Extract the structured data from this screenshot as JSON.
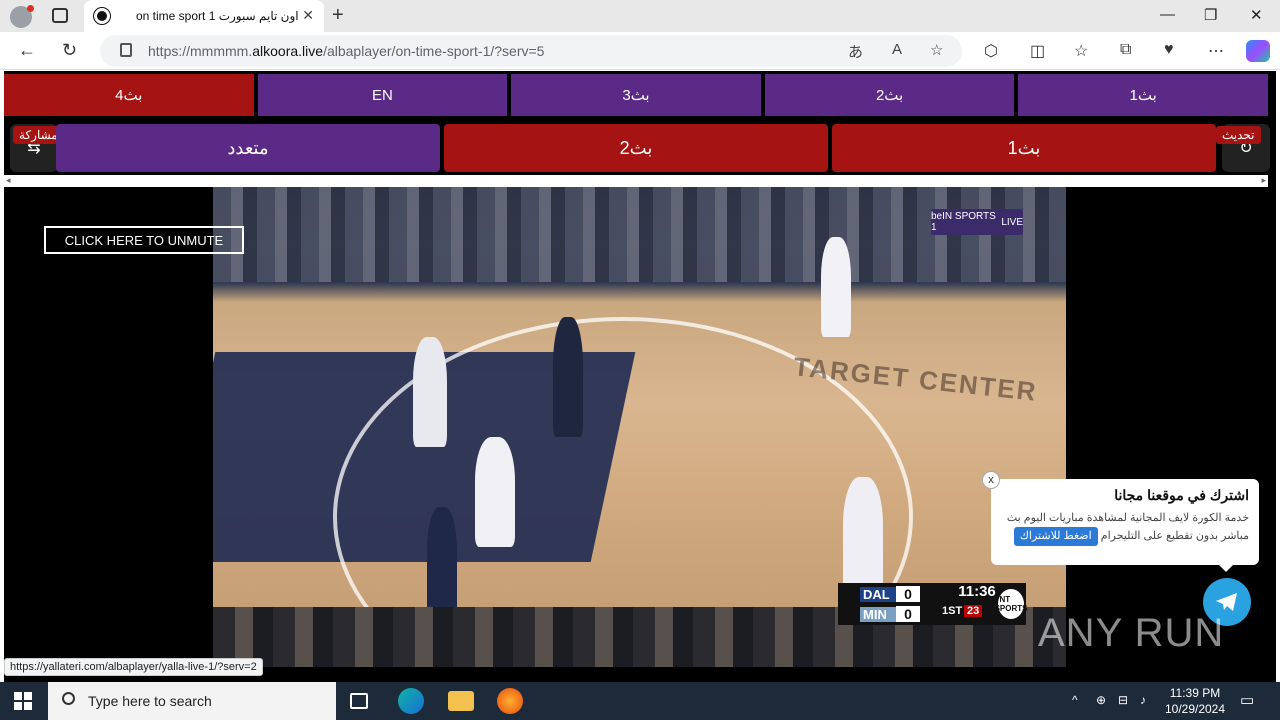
{
  "browser": {
    "tab_title": "on time sport 1 اون تايم سبورت",
    "url_prefix": "https://mmmmm.",
    "url_domain": "alkoora.live",
    "url_path": "/albaplayer/on-time-sport-1/?serv=5",
    "new_tab": "+",
    "close_tab": "✕",
    "minimize": "—",
    "maximize": "❐",
    "close_window": "✕"
  },
  "servers_row1": [
    {
      "label": "بث4",
      "color": "#a51313"
    },
    {
      "label": "EN",
      "color": "#5b2a86"
    },
    {
      "label": "بث3",
      "color": "#5b2a86"
    },
    {
      "label": "بث2",
      "color": "#5b2a86"
    },
    {
      "label": "بث1",
      "color": "#5b2a86"
    }
  ],
  "servers_row2": [
    {
      "label": "متعدد",
      "color": "#5b2a86"
    },
    {
      "label": "بث2",
      "color": "#a51313"
    },
    {
      "label": "بث1",
      "color": "#a51313"
    }
  ],
  "share_label": "مشاركة",
  "refresh_label": "تحديث",
  "unmute_label": "CLICK HERE TO UNMUTE",
  "video": {
    "channel": "beIN SPORTS 1",
    "live": "LIVE",
    "court_text": "TARGET CENTER",
    "score": {
      "team1": "DAL",
      "team1_pts": "0",
      "team2": "MIN",
      "team2_pts": "0",
      "clock": "11:36",
      "period": "1ST",
      "shot_clock": "23",
      "network": "TNT SPORTS"
    }
  },
  "popup": {
    "title": "اشترك في موقعنا مجانا",
    "description": "خدمة الكورة لايف المجانية لمشاهدة مباريات اليوم بث مباشر بدون تقطيع على التليجرام",
    "cta": "اضغط للاشتراك",
    "close": "x"
  },
  "watermark": "ANY RUN",
  "status_link": "https://yallateri.com/albaplayer/yalla-live-1/?serv=2",
  "taskbar": {
    "search_placeholder": "Type here to search",
    "time": "11:39 PM",
    "date": "10/29/2024"
  }
}
